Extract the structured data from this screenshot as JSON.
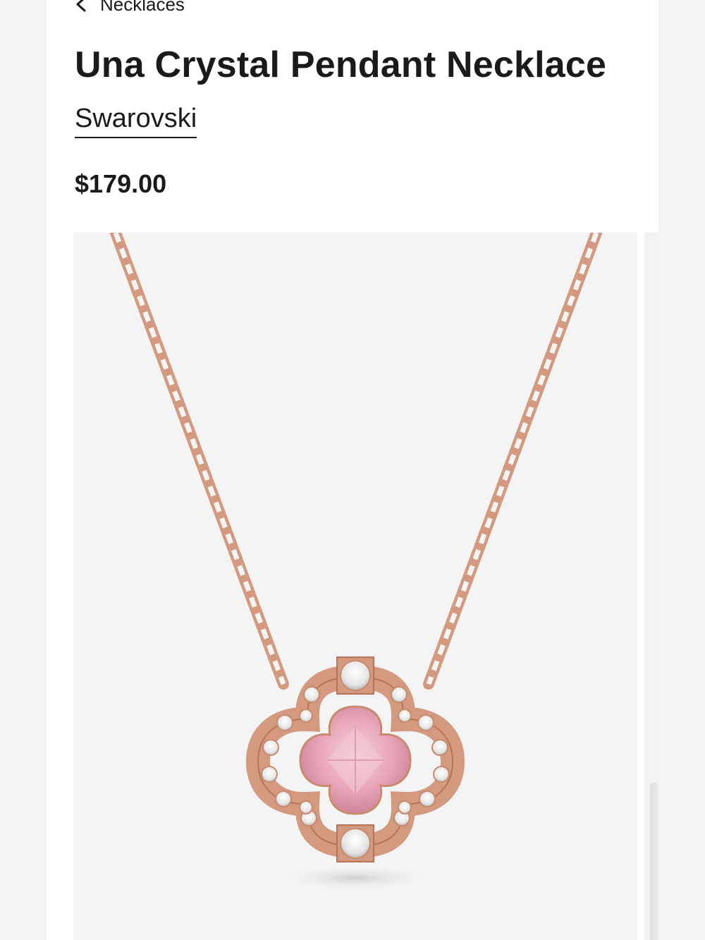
{
  "breadcrumb": {
    "label": "Necklaces",
    "icon": "chevron-left-icon"
  },
  "product": {
    "title": "Una Crystal Pendant Necklace",
    "brand": "Swarovski",
    "price": "$179.00"
  },
  "colors": {
    "text": "#1a1a1a",
    "chain": "#c98a6e",
    "crystal_pink": "#e8a6b8",
    "background": "#f4f4f4"
  }
}
